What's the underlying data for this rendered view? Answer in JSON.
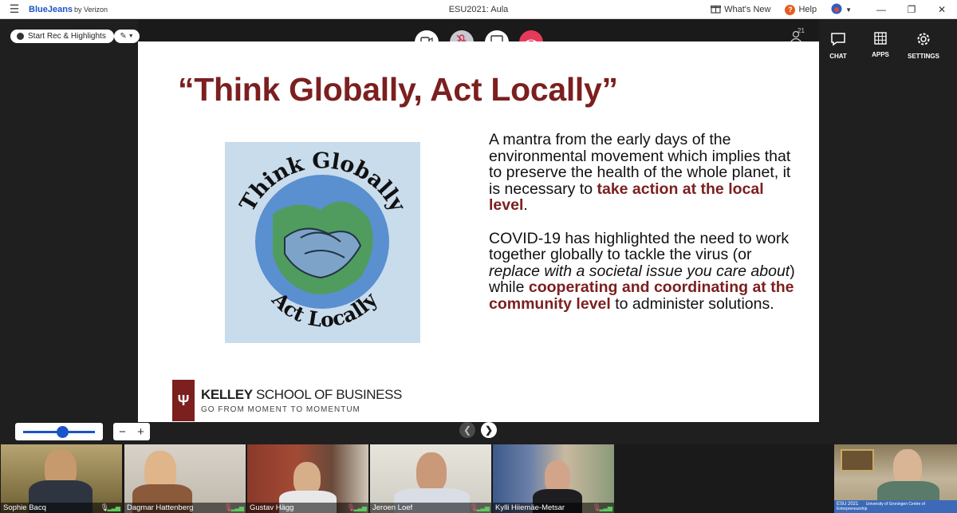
{
  "app": {
    "brand": "BlueJeans",
    "brand_suffix": "by Verizon",
    "window_title": "ESU2021: Aula",
    "whats_new": "What's New",
    "help": "Help"
  },
  "toolbar": {
    "start_rec_label": "Start Rec & Highlights",
    "participants_count": "21"
  },
  "right_panel": {
    "chat_label": "CHAT",
    "apps_label": "APPS",
    "settings_label": "SETTINGS"
  },
  "slide": {
    "title": "“Think Globally, Act Locally”",
    "image_top_text": "Think Globally",
    "image_bottom_text": "Act Locally",
    "para1_a": "A mantra from the early days of the environmental movement which implies that to preserve the health of the whole planet, it is necessary to ",
    "para1_hl": "take action at the local level",
    "para1_b": ".",
    "para2_a": "COVID-19 has highlighted the need to work together globally to tackle the virus (or ",
    "para2_italic": "replace with a societal issue you care about",
    "para2_b": ") while ",
    "para2_hl1": "cooperating and coordinating at the community level",
    "para2_c": " to administer solutions.",
    "school_bold": "KELLEY",
    "school_rest": " SCHOOL OF BUSINESS",
    "school_tagline": "GO FROM MOMENT TO MOMENTUM"
  },
  "zoom": {
    "level": 0.55
  },
  "participants": [
    {
      "name": "Sophie Bacq",
      "active": true
    },
    {
      "name": "Dagmar Hattenberg",
      "active": false
    },
    {
      "name": "Gustav Hägg",
      "active": false
    },
    {
      "name": "Jeroen Loef",
      "active": false
    },
    {
      "name": "Kylli Hiiemäe-Metsar",
      "active": false
    }
  ],
  "self_view": {
    "label": "ESU 2021",
    "sub": "University of Groningen Centre of Entrepreneurship"
  },
  "colors": {
    "brand_blue": "#1a54c8",
    "slide_red": "#7c1f1f",
    "hangup_red": "#e53a5a",
    "active_green": "#3cc870"
  }
}
